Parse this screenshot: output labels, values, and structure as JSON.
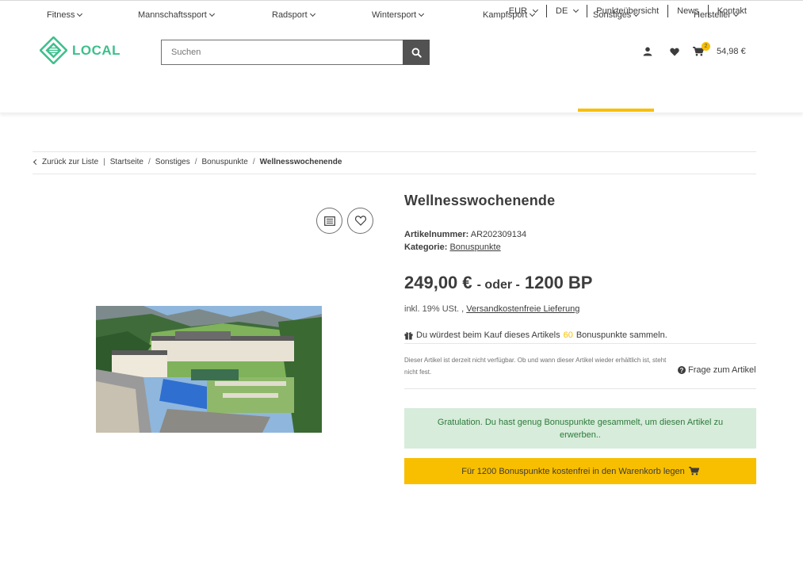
{
  "topbar": {
    "currency": "EUR",
    "language": "DE",
    "points_overview": "Punkteübersicht",
    "news": "News",
    "contact": "Kontakt"
  },
  "header": {
    "logo_text": "LOCAL",
    "search_placeholder": "Suchen",
    "cart_count": "2",
    "cart_total": "54,98 €"
  },
  "categories": [
    {
      "label": "Fitness"
    },
    {
      "label": "Mannschaftssport"
    },
    {
      "label": "Radsport"
    },
    {
      "label": "Wintersport"
    },
    {
      "label": "Kampfsport"
    },
    {
      "label": "Sonstiges",
      "active": true
    },
    {
      "label": "Hersteller"
    }
  ],
  "breadcrumb": {
    "back": "Zurück zur Liste",
    "items": [
      "Startseite",
      "Sonstiges",
      "Bonuspunkte"
    ],
    "current": "Wellnesswochenende"
  },
  "product": {
    "title": "Wellnesswochenende",
    "sku_label": "Artikelnummer:",
    "sku": "AR202309134",
    "category_label": "Kategorie:",
    "category": "Bonuspunkte",
    "price": "249,00 €",
    "price_or": "- oder -",
    "price_points": "1200 BP",
    "vat_text": "inkl. 19% USt. ,",
    "shipping_link": "Versandkostenfreie Lieferung",
    "bonus_before": "Du würdest beim Kauf dieses Artikels",
    "bonus_points": "60",
    "bonus_after": "Bonuspunkte sammeln.",
    "availability": "Dieser Artikel ist derzeit nicht verfügbar. Ob und wann dieser Artikel wieder erhältlich ist, steht nicht fest.",
    "question": "Frage zum Artikel",
    "success_message": "Gratulation. Du hast genug Bonuspunkte gesammelt, um diesen Artikel zu erwerben..",
    "cart_button": "Für 1200 Bonuspunkte kostenfrei in den Warenkorb legen"
  },
  "colors": {
    "accent": "#f8bf00",
    "logo": "#3dbf8c",
    "success_bg": "#d7ecdb",
    "success_text": "#2d7a3a"
  },
  "icons": [
    "search-icon",
    "user-icon",
    "heart-icon",
    "cart-icon",
    "compare-icon",
    "wishlist-icon",
    "gift-icon",
    "question-icon",
    "chevron-down-icon",
    "chevron-left-icon"
  ]
}
